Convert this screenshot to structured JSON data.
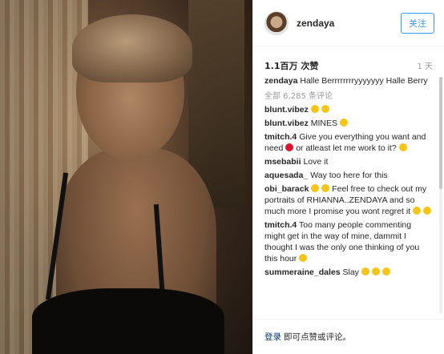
{
  "header": {
    "username": "zendaya",
    "follow_label": "关注"
  },
  "meta": {
    "likes": "1.1百万 次赞",
    "time": "1 天"
  },
  "caption": {
    "user": "zendaya",
    "text": "Halle Berrrrrrrryyyyyyy Halle Berry"
  },
  "view_all": "全部 6,285 条评论",
  "comments": [
    {
      "user": "blunt.vibez",
      "text": "",
      "emojis": [
        "y",
        "y"
      ]
    },
    {
      "user": "blunt.vibez",
      "text": "MINES",
      "emojis": [
        "y"
      ]
    },
    {
      "user": "tmitch.4",
      "text": "Give you everything you want and need",
      "text2": "or atleast let me work to it?",
      "emojis": [
        "r"
      ],
      "emojis2": [
        "y"
      ]
    },
    {
      "user": "msebabii",
      "text": "Love it"
    },
    {
      "user": "aquesada_",
      "text": "Way too here for this"
    },
    {
      "user": "obi_barack",
      "text": "Feel free to check out my portraits of RHIANNA..ZENDAYA and so much more I promise you wont regret it",
      "emojis_pre": [
        "y",
        "y"
      ],
      "emojis": [
        "y",
        "y"
      ]
    },
    {
      "user": "tmitch.4",
      "text": "Too many people commenting might get in the way of mine, dammit I thought I was the only one thinking of you this hour",
      "emojis": [
        "y"
      ]
    },
    {
      "user": "summeraine_dales",
      "text": "Slay",
      "emojis": [
        "y",
        "y",
        "y"
      ]
    }
  ],
  "footer": {
    "login": "登录",
    "rest": "即可点赞或评论。"
  }
}
